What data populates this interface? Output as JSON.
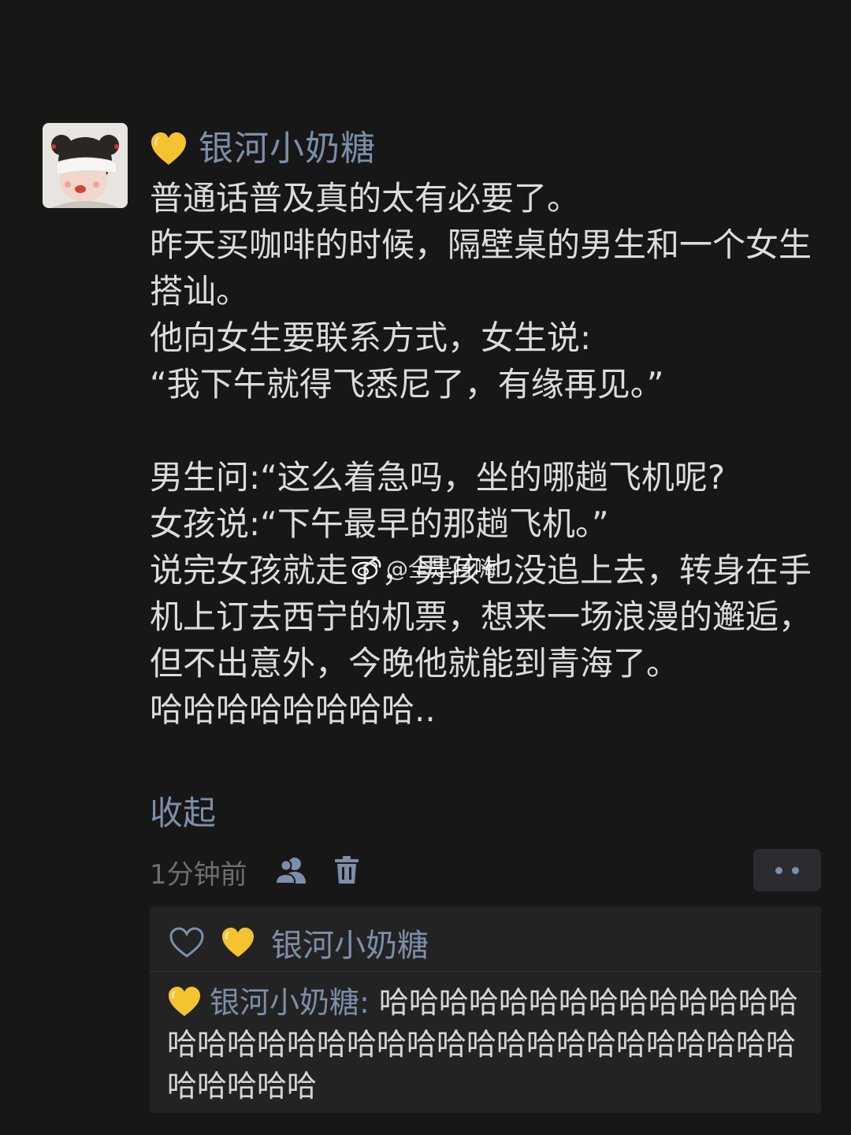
{
  "post": {
    "author": "银河小奶糖",
    "lines": [
      "普通话普及真的太有必要了。",
      "昨天买咖啡的时候，隔壁桌的男生和一个女生搭讪。",
      "他向女生要联系方式，女生说:",
      "“我下午就得飞悉尼了，有缘再见。”",
      "",
      "男生问:“这么着急吗，坐的哪趟飞机呢?",
      "女孩说:“下午最早的那趟飞机。”",
      "说完女孩就走了，男孩也没追上去，转身在手机上订去西宁的机票，想来一场浪漫的邂逅，但不出意外，今晚他就能到青海了。",
      "哈哈哈哈哈哈哈哈.."
    ],
    "collapse_label": "收起",
    "time": "1分钟前"
  },
  "watermark": {
    "text": "@全是且嗨"
  },
  "reply_panel": {
    "liker": "银河小奶糖",
    "comment_author": "银河小奶糖",
    "comment_separator": ": ",
    "comment_text": "哈哈哈哈哈哈哈哈哈哈哈哈哈哈哈哈哈哈哈哈哈哈哈哈哈哈哈哈哈哈哈哈哈哈哈哈哈哈哈哈"
  },
  "icons": {
    "heart_emoji": "yellow-heart-icon",
    "visibility": "friends-icon",
    "delete": "trash-icon",
    "more": "more-dots-icon",
    "like": "heart-outline-icon"
  },
  "colors": {
    "background": "#171717",
    "link": "#7d8ea8",
    "text": "#dcdcdc",
    "panel": "#232323",
    "heart_yellow": "#f6c330"
  }
}
